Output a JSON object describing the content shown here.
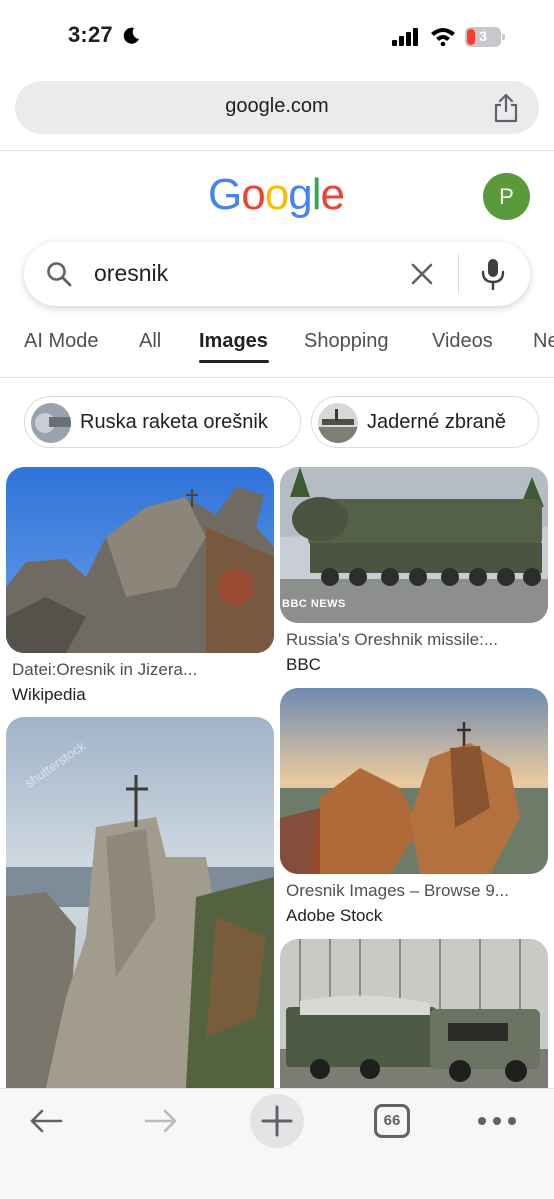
{
  "status_bar": {
    "time": "3:27",
    "battery": "3"
  },
  "browser": {
    "url": "google.com",
    "tab_count": "66"
  },
  "google": {
    "logo_letters": [
      "G",
      "o",
      "o",
      "g",
      "l",
      "e"
    ],
    "logo_colors": [
      "#4285F4",
      "#EA4335",
      "#FBBC05",
      "#4285F4",
      "#34A853",
      "#EA4335"
    ],
    "avatar_initial": "P"
  },
  "search": {
    "query": "oresnik"
  },
  "tabs": [
    {
      "label": "AI Mode",
      "active": false
    },
    {
      "label": "All",
      "active": false
    },
    {
      "label": "Images",
      "active": true
    },
    {
      "label": "Shopping",
      "active": false
    },
    {
      "label": "Videos",
      "active": false
    },
    {
      "label": "Ne",
      "active": false
    }
  ],
  "chips": [
    {
      "label": "Ruska raketa orešnik"
    },
    {
      "label": "Jaderné zbraně"
    }
  ],
  "results": [
    {
      "caption": "Datei:Oresnik in Jizera...",
      "source": "Wikipedia"
    },
    {
      "caption": "Russia's Oreshnik missile:...",
      "source": "BBC",
      "overlay": "BBC NEWS"
    },
    {
      "caption": "",
      "source": "",
      "watermark": "shutterstock"
    },
    {
      "caption": "Oresnik Images – Browse 9...",
      "source": "Adobe Stock"
    },
    {
      "caption": "",
      "source": ""
    }
  ],
  "colors": {
    "accent": "#1a73e8",
    "avatar_bg": "#5a9a3a",
    "toolbar_bg": "#f7f7f8"
  }
}
